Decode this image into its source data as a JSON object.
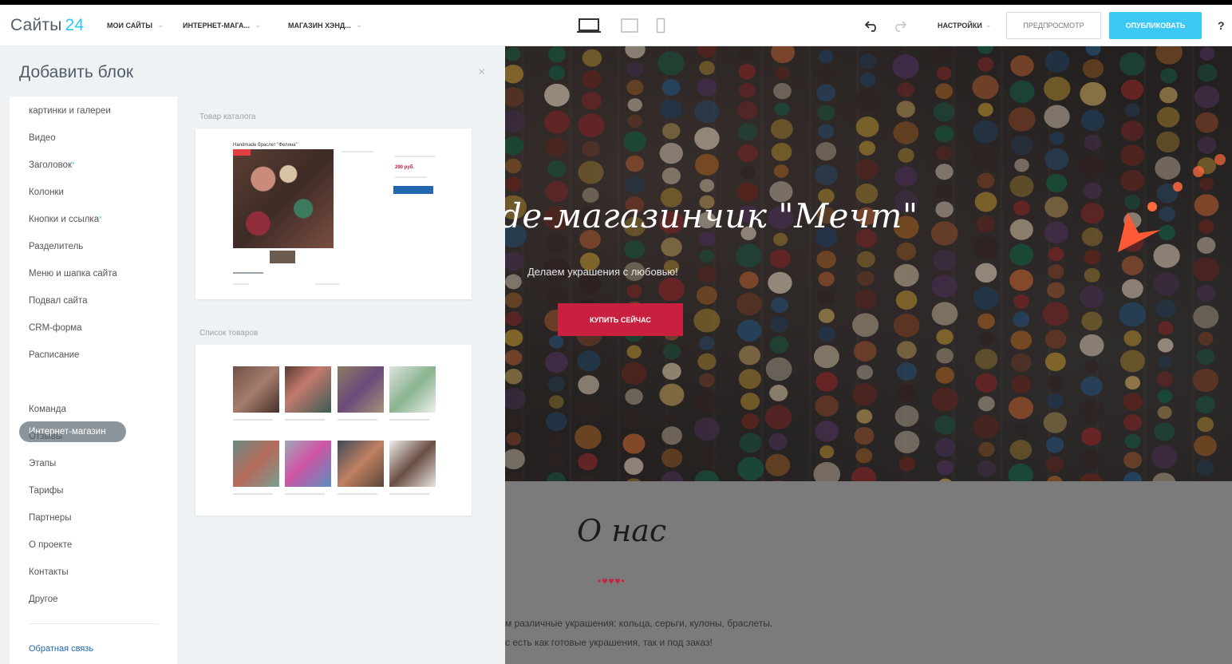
{
  "app": {
    "logo_name": "Сайты",
    "logo_num": "24"
  },
  "breadcrumbs": [
    "МОИ САЙТЫ",
    "ИНТЕРНЕТ-МАГА...",
    "МАГАЗИН ХЭНД..."
  ],
  "toolbar": {
    "settings_label": "НАСТРОЙКИ",
    "preview_label": "ПРЕДПРОСМОТР",
    "publish_label": "ОПУБЛИКОВАТЬ",
    "help_label": "?"
  },
  "panel": {
    "title": "Добавить блок",
    "categories": [
      {
        "label": "картинки и галереи",
        "star": ""
      },
      {
        "label": "Видео",
        "star": ""
      },
      {
        "label": "Заголовок",
        "star": "*"
      },
      {
        "label": "Колонки",
        "star": ""
      },
      {
        "label": "Кнопки и ссылка",
        "star": "*"
      },
      {
        "label": "Разделитель",
        "star": ""
      },
      {
        "label": "Меню и шапка сайта",
        "star": ""
      },
      {
        "label": "Подвал сайта",
        "star": ""
      },
      {
        "label": "CRM-форма",
        "star": ""
      },
      {
        "label": "Расписание",
        "star": ""
      },
      {
        "label": "Интернет-магазин",
        "star": "",
        "active": true
      },
      {
        "label": "Команда",
        "star": ""
      },
      {
        "label": "Отзывы",
        "star": ""
      },
      {
        "label": "Этапы",
        "star": ""
      },
      {
        "label": "Тарифы",
        "star": ""
      },
      {
        "label": "Партнеры",
        "star": ""
      },
      {
        "label": "О проекте",
        "star": ""
      },
      {
        "label": "Контакты",
        "star": ""
      },
      {
        "label": "Другое",
        "star": ""
      }
    ],
    "feedback_label": "Обратная связь",
    "sections": [
      {
        "label": "Товар каталога"
      },
      {
        "label": "Список товаров"
      }
    ],
    "product_card": {
      "title": "Handmade браслет \"Фелина\"",
      "price": "290 руб."
    }
  },
  "site": {
    "hero_title": "de-магазинчик \"Мечт\"",
    "hero_subtitle": "Делаем украшения с любовью!",
    "hero_button": "КУПИТЬ СЕЙЧАС",
    "about_title": "О нас",
    "about_hearts": "•♥♥♥•",
    "about_line1": "м различные украшения: кольца, серьги, кулоны, браслеты.",
    "about_line2": "с есть как готовые украшения, так и под заказ!"
  },
  "colors": {
    "accent_blue": "#3bc8f5",
    "brand_red": "#c9203f",
    "active_chip": "#8d959c"
  }
}
